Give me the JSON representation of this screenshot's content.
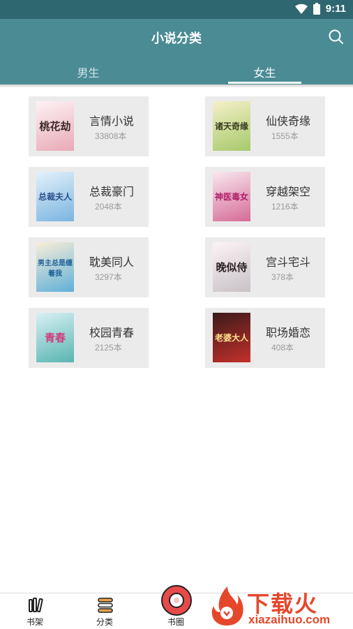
{
  "status_bar": {
    "time": "9:11"
  },
  "app_bar": {
    "title": "小说分类"
  },
  "tabs": [
    {
      "label": "男生",
      "active": false
    },
    {
      "label": "女生",
      "active": true
    }
  ],
  "categories": [
    {
      "name": "言情小说",
      "count": "33808本",
      "cover_text": "桃花劫",
      "cover_colors": [
        "#fdf2f4",
        "#e8a9b7"
      ],
      "cover_text_color": "#3a2a2a"
    },
    {
      "name": "仙侠奇缘",
      "count": "1555本",
      "cover_text": "诸天奇缘",
      "cover_colors": [
        "#f5f0c8",
        "#a6c96a"
      ],
      "cover_text_color": "#3a3a20"
    },
    {
      "name": "总裁豪门",
      "count": "2048本",
      "cover_text": "总裁夫人",
      "cover_colors": [
        "#e3f1fb",
        "#7ab4e0"
      ],
      "cover_text_color": "#2b4f8a"
    },
    {
      "name": "穿越架空",
      "count": "1216本",
      "cover_text": "神医毒女",
      "cover_colors": [
        "#f8e8ef",
        "#d56b96"
      ],
      "cover_text_color": "#b0206a"
    },
    {
      "name": "耽美同人",
      "count": "3297本",
      "cover_text": "男主总是缠着我",
      "cover_colors": [
        "#f9eed7",
        "#5fb0d9"
      ],
      "cover_text_color": "#1e5f9a"
    },
    {
      "name": "宫斗宅斗",
      "count": "378本",
      "cover_text": "晚似侍",
      "cover_colors": [
        "#fbf3f5",
        "#c8c1c6"
      ],
      "cover_text_color": "#2a2222"
    },
    {
      "name": "校园青春",
      "count": "2125本",
      "cover_text": "青春",
      "cover_colors": [
        "#d9f0f5",
        "#58b5b0"
      ],
      "cover_text_color": "#d23b7c"
    },
    {
      "name": "职场婚恋",
      "count": "408本",
      "cover_text": "老婆大人",
      "cover_colors": [
        "#3b1a1a",
        "#c4302b"
      ],
      "cover_text_color": "#ffe08a"
    }
  ],
  "bottom_nav": [
    {
      "label": "书架",
      "icon": "bookshelf-icon"
    },
    {
      "label": "分类",
      "icon": "category-icon"
    },
    {
      "label": "书圈",
      "icon": "book-circle-icon"
    }
  ],
  "watermark": {
    "text": "下载火",
    "url": "xiazaihuo.com"
  },
  "colors": {
    "app_bar": "#4a8b94",
    "status_bar": "#2f6770",
    "card": "#ebebeb",
    "accent": "#e5472b"
  }
}
